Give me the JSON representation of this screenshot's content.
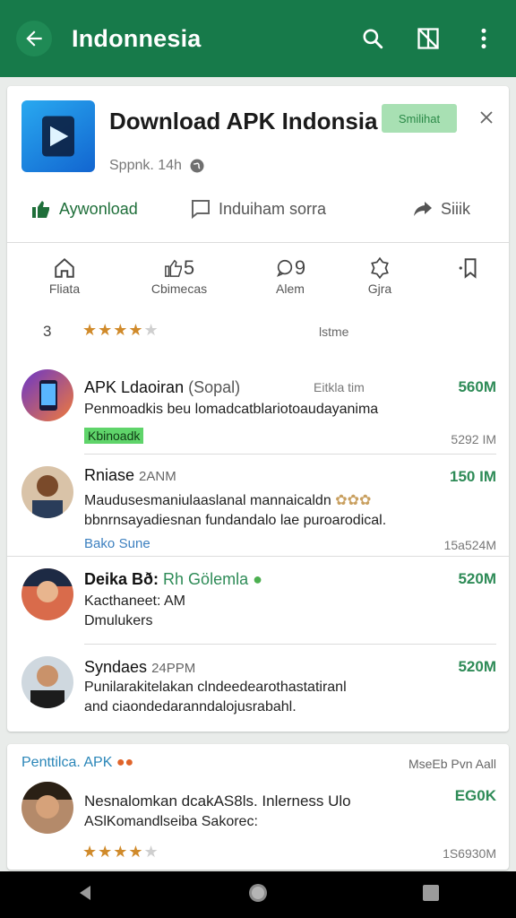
{
  "appbar": {
    "title": "Indonnesia",
    "bg_color": "#177a4a"
  },
  "app": {
    "title": "Download APK Indonsia",
    "badge": "Smilihat",
    "subtitle": "Sppnk. 14h",
    "actions": {
      "download": "Aywonload",
      "index": "Induiham sorra",
      "share": "Siiik"
    }
  },
  "stats": [
    {
      "icon": "home-icon",
      "label": "Fliata"
    },
    {
      "icon": "thumbs-up-icon",
      "value": "5",
      "label": "Cbimecas"
    },
    {
      "icon": "comment-icon",
      "value": "9",
      "label": "Alem"
    },
    {
      "icon": "badge-icon",
      "label": "Gjra"
    },
    {
      "icon": "bookmark-icon",
      "label": ""
    }
  ],
  "rating": {
    "prefix": "3",
    "stars": 4,
    "label": "lstme"
  },
  "items": [
    {
      "name": "APK Ldaoiran",
      "name_extra": "(Sopal)",
      "meta": "Eitkla tim",
      "line1": "Penmoadkis beu lomadcatblariotoaudayanima",
      "tag": "Kbinoadk",
      "size": "560M",
      "date": "5292 IM"
    },
    {
      "name": "Rniase",
      "name_extra": "2ANM",
      "line1": "Maudusesmaniulaaslanal mannaicaldn",
      "line2": "bbnrnsayadiesnan fundandalo lae puroarodical.",
      "link": "Bako",
      "link2": "Sune",
      "size": "150 IM",
      "date": "15a524M"
    },
    {
      "name": "Deika Bð:",
      "name_extra": "Rh Gölemla",
      "line1": "Kacthaneet: AM",
      "orange": "Dmulukers",
      "size": "520M"
    },
    {
      "name": "Syndaes",
      "name_extra": "24PPM",
      "line1": "Punilarakitelakan clndeedearothastatiranl",
      "line2": "and ciaondedaranndalojusrabahl.",
      "size": "520M"
    }
  ],
  "card2": {
    "header_left": "Penttilca. APK",
    "header_right": "MseEb Pvn Aall",
    "item": {
      "line1": "Nesnalomkan dcakAS8ls. Inlerness Ulo",
      "line2": "ASlKomandlseiba Sakorec:",
      "size": "EG0K",
      "stars": 4,
      "date": "1S6930M"
    }
  }
}
